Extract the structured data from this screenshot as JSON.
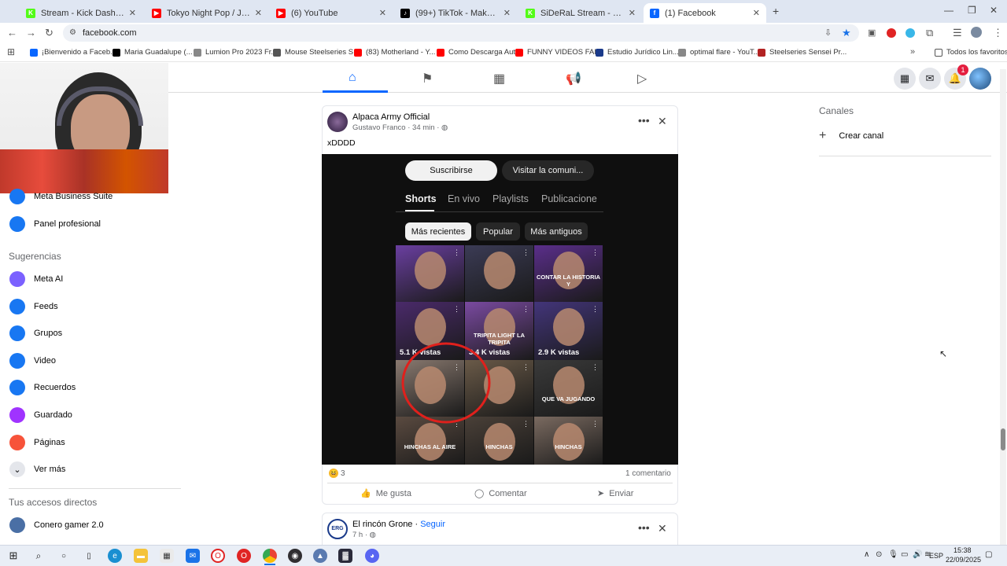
{
  "browser": {
    "tabs": [
      {
        "title": "Stream - Kick Dashboard",
        "icon_color": "#53fc18",
        "icon": "K"
      },
      {
        "title": "Tokyo Night Pop / Japanese Ne",
        "icon_color": "#ff0000",
        "icon": "▶"
      },
      {
        "title": "(6) YouTube",
        "icon_color": "#ff0000",
        "icon": "▶"
      },
      {
        "title": "(99+) TikTok - Make Your Day",
        "icon_color": "#000000",
        "icon": "♪"
      },
      {
        "title": "SiDeRaL Stream - Watch Live o",
        "icon_color": "#53fc18",
        "icon": "K"
      },
      {
        "title": "(1) Facebook",
        "icon_color": "#0866ff",
        "icon": "f"
      }
    ],
    "url": "facebook.com",
    "bookmarks": [
      {
        "label": "¡Bienvenido a Faceb...",
        "color": "#0866ff"
      },
      {
        "label": "Maria Guadalupe (...",
        "color": "#000000"
      },
      {
        "label": "Lumion Pro 2023 Fr...",
        "color": "#888888"
      },
      {
        "label": "Mouse Steelseries S...",
        "color": "#555555"
      },
      {
        "label": "(83) Motherland - Y...",
        "color": "#ff0000"
      },
      {
        "label": "Como Descarga Aut...",
        "color": "#ff0000"
      },
      {
        "label": "FUNNY VIDEOS FAI...",
        "color": "#ff0000"
      },
      {
        "label": "Estudio Jurídico Lin...",
        "color": "#1a3a8a"
      },
      {
        "label": "optimal flare - YouT...",
        "color": "#888888"
      },
      {
        "label": "Steelseries Sensei Pr...",
        "color": "#b22222"
      }
    ],
    "all_bookmarks": "Todos los favoritos"
  },
  "facebook": {
    "notifications_badge": "1",
    "sidebar": {
      "top_items": [
        {
          "label": "Meta Business Suite",
          "icon": "business-suite-icon",
          "color": "#1877f2"
        },
        {
          "label": "Panel profesional",
          "icon": "professional-dashboard-icon",
          "color": "#1877f2"
        }
      ],
      "suggestions_header": "Sugerencias",
      "suggestions": [
        {
          "label": "Meta AI",
          "icon": "meta-ai-icon",
          "color": "#7b61ff"
        },
        {
          "label": "Feeds",
          "icon": "feeds-icon",
          "color": "#1877f2"
        },
        {
          "label": "Grupos",
          "icon": "groups-icon",
          "color": "#1877f2"
        },
        {
          "label": "Video",
          "icon": "video-icon",
          "color": "#1877f2"
        },
        {
          "label": "Recuerdos",
          "icon": "memories-icon",
          "color": "#1877f2"
        },
        {
          "label": "Guardado",
          "icon": "saved-icon",
          "color": "#a033ff"
        },
        {
          "label": "Páginas",
          "icon": "pages-icon",
          "color": "#f7533a"
        },
        {
          "label": "Ver más",
          "icon": "chevron-down-icon",
          "color": "#e4e6eb"
        }
      ],
      "shortcuts_header": "Tus accesos directos",
      "shortcuts": [
        {
          "label": "Conero gamer 2.0",
          "icon": "shortcut-avatar-icon",
          "color": "#4a6fa5"
        }
      ]
    },
    "post": {
      "page_name": "Alpaca Army Official",
      "author": "Gustavo Franco",
      "time": "34 min",
      "text": "xDDDD",
      "reactions_count": "3",
      "comments": "1 comentario",
      "actions": {
        "like": "Me gusta",
        "comment": "Comentar",
        "share": "Enviar"
      }
    },
    "video": {
      "subscribe": "Suscribirse",
      "visit": "Visitar la comuni...",
      "tabs": [
        "Shorts",
        "En vivo",
        "Playlists",
        "Publicacione"
      ],
      "chips": [
        "Más recientes",
        "Popular",
        "Más antiguos"
      ],
      "thumbnails": [
        {
          "views": "",
          "caption": "",
          "bg": "#6a3fa0"
        },
        {
          "views": "",
          "caption": "",
          "bg": "#3b3b55"
        },
        {
          "views": "",
          "caption": "CONTAR LA HISTORIA Y",
          "bg": "#5a2e8a"
        },
        {
          "views": "5.1 K vistas",
          "caption": "",
          "bg": "#4a2a6a"
        },
        {
          "views": "3.4 K vistas",
          "caption": "TRIPITA LIGHT LA TRIPITA",
          "bg": "#7a4aa0"
        },
        {
          "views": "2.9 K vistas",
          "caption": "",
          "bg": "#43357a"
        },
        {
          "views": "",
          "caption": "",
          "bg": "#8a7a70"
        },
        {
          "views": "",
          "caption": "",
          "bg": "#6a5a48"
        },
        {
          "views": "",
          "caption": "QUE VA JUGANDO",
          "bg": "#3a3a3a"
        },
        {
          "views": "",
          "caption": "HINCHAS AL AIRE",
          "bg": "#5a4a40"
        },
        {
          "views": "",
          "caption": "HINCHAS",
          "bg": "#4a4038"
        },
        {
          "views": "",
          "caption": "HINCHAS",
          "bg": "#7a6a60"
        }
      ]
    },
    "next_post": {
      "page_name": "El rincón Grone",
      "follow": "Seguir",
      "time": "7 h",
      "avatar_text": "ERG"
    },
    "right_panel": {
      "channels_header": "Canales",
      "create_channel": "Crear canal"
    }
  },
  "taskbar": {
    "language": "ESP",
    "time": "15:38",
    "date": "22/09/2025"
  }
}
